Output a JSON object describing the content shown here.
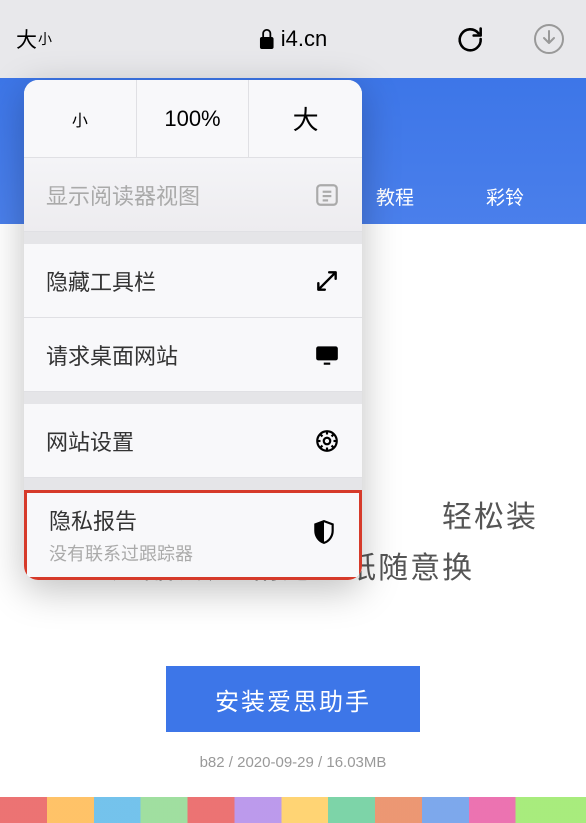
{
  "topbar": {
    "aa_large": "大",
    "aa_small": "小",
    "url_host": "i4.cn"
  },
  "nav": {
    "tutorials": "教程",
    "ringtones": "彩铃"
  },
  "page": {
    "tagline_row1": "轻松装",
    "tagline_row2": "炫酷铃声 精选壁纸随意换",
    "install_button": "安装爱思助手",
    "meta": "b82 / 2020-09-29 / 16.03MB"
  },
  "popover": {
    "zoom_small": "小",
    "zoom_value": "100%",
    "zoom_large": "大",
    "reader_view": "显示阅读器视图",
    "hide_toolbar": "隐藏工具栏",
    "request_desktop": "请求桌面网站",
    "website_settings": "网站设置",
    "privacy_report": "隐私报告",
    "privacy_sub": "没有联系过跟踪器"
  }
}
